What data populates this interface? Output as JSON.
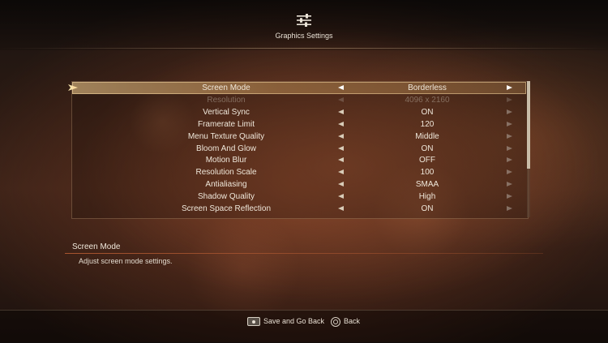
{
  "header": {
    "title": "Graphics Settings",
    "icon": "sliders-icon"
  },
  "settings": [
    {
      "label": "Screen Mode",
      "value": "Borderless",
      "selected": true,
      "disabled": false
    },
    {
      "label": "Resolution",
      "value": "4096 x 2160",
      "selected": false,
      "disabled": true
    },
    {
      "label": "Vertical Sync",
      "value": "ON",
      "selected": false,
      "disabled": false
    },
    {
      "label": "Framerate Limit",
      "value": "120",
      "selected": false,
      "disabled": false
    },
    {
      "label": "Menu Texture Quality",
      "value": "Middle",
      "selected": false,
      "disabled": false
    },
    {
      "label": "Bloom And Glow",
      "value": "ON",
      "selected": false,
      "disabled": false
    },
    {
      "label": "Motion Blur",
      "value": "OFF",
      "selected": false,
      "disabled": false
    },
    {
      "label": "Resolution Scale",
      "value": "100",
      "selected": false,
      "disabled": false
    },
    {
      "label": "Antialiasing",
      "value": "SMAA",
      "selected": false,
      "disabled": false
    },
    {
      "label": "Shadow Quality",
      "value": "High",
      "selected": false,
      "disabled": false
    },
    {
      "label": "Screen Space Reflection",
      "value": "ON",
      "selected": false,
      "disabled": false
    }
  ],
  "description": {
    "title": "Screen Mode",
    "text": "Adjust screen mode settings."
  },
  "footer": {
    "save_label": "Save and Go Back",
    "save_icon": "touchpad-button-icon",
    "back_label": "Back",
    "back_icon": "circle-button-icon"
  },
  "colors": {
    "selected_highlight": "#e8c48a",
    "accent_rule": "#b45a32",
    "text": "#efe7da"
  }
}
